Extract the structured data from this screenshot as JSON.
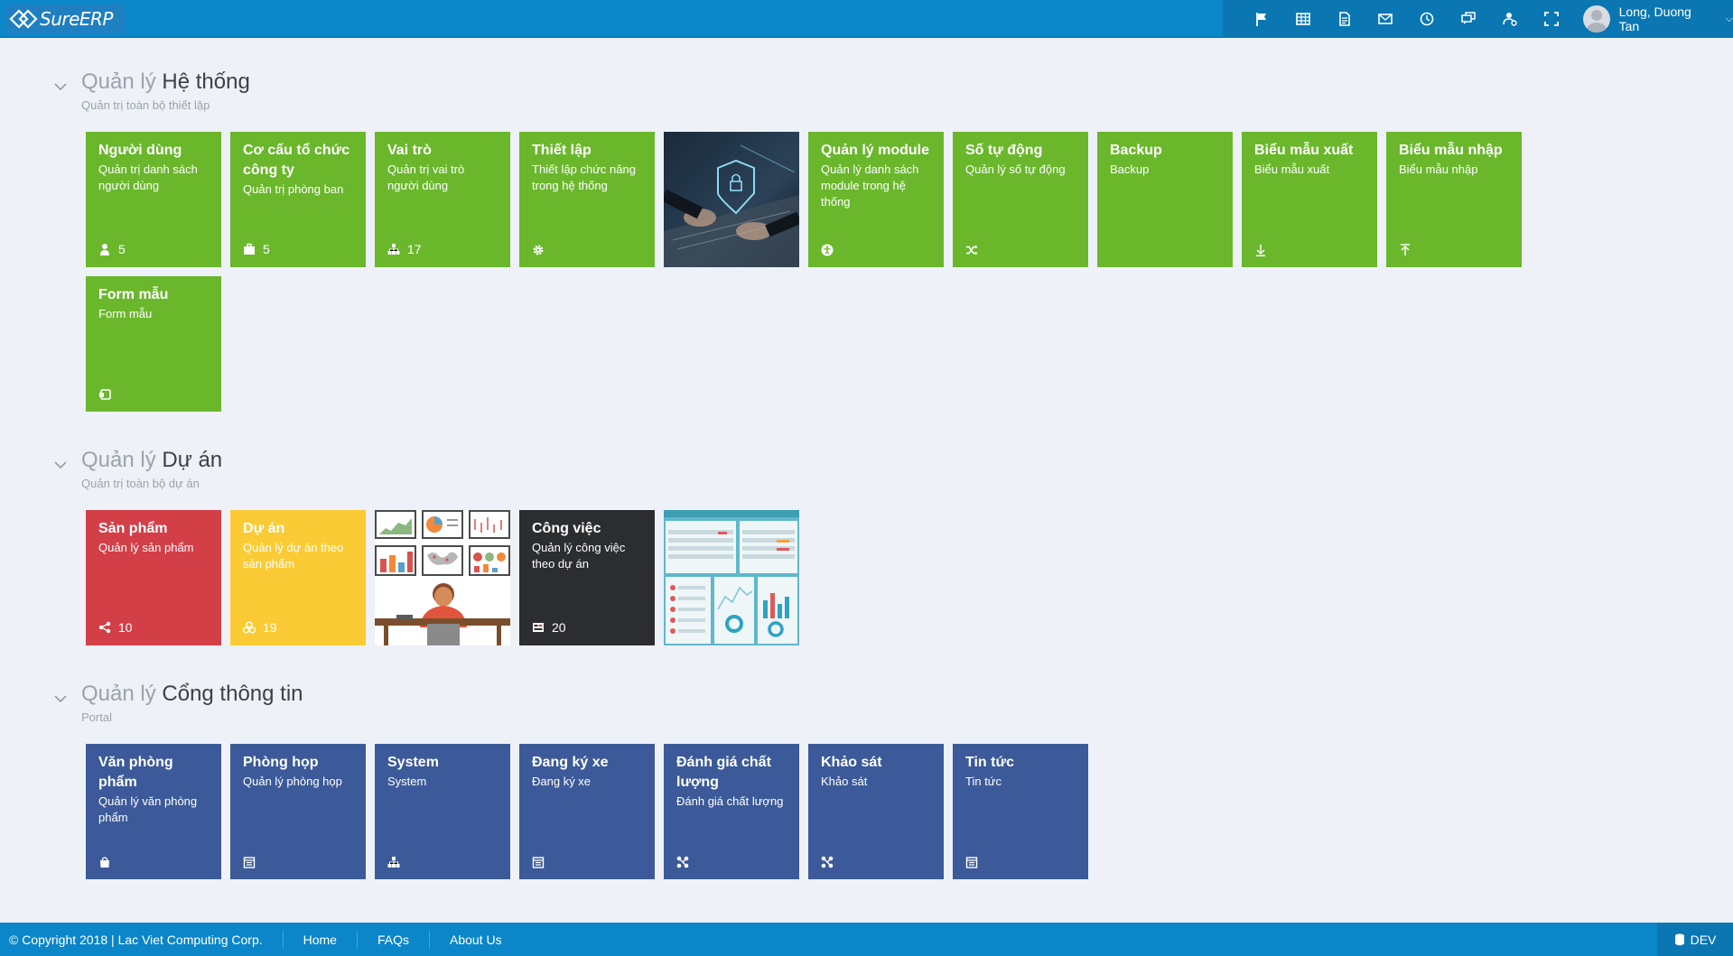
{
  "app": {
    "logo_text": "SureERP",
    "user_name": "Long, Duong Tan"
  },
  "toolbar_icons": [
    "flag-icon",
    "table-icon",
    "document-icon",
    "mail-icon",
    "clock-icon",
    "chat-icon",
    "user-settings-icon",
    "fullscreen-icon"
  ],
  "sections": [
    {
      "title_prefix": "Quản lý",
      "title_main": "Hệ thống",
      "subtitle": "Quản trị toàn bộ thiết lập",
      "tiles": [
        {
          "title": "Người dùng",
          "desc": "Quản trị danh sách người dùng",
          "icon": "user-icon",
          "count": "5"
        },
        {
          "title": "Cơ cấu tổ chức công ty",
          "desc": "Quản trị phòng ban",
          "icon": "briefcase-icon",
          "count": "5"
        },
        {
          "title": "Vai trò",
          "desc": "Quản trị vai trò người dùng",
          "icon": "sitemap-icon",
          "count": "17"
        },
        {
          "title": "Thiết lập",
          "desc": "Thiết lập chức năng trong hệ thống",
          "icon": "gear-icon",
          "count": ""
        },
        {
          "title": "Quản lý module",
          "desc": "Quản lý danh sách module trong hệ thống",
          "icon": "accessibility-icon",
          "count": ""
        },
        {
          "title": "Số tự động",
          "desc": "Quản lý số tự động",
          "icon": "shuffle-icon",
          "count": ""
        },
        {
          "title": "Backup",
          "desc": "Backup",
          "icon": "",
          "count": ""
        },
        {
          "title": "Biểu mẫu xuất",
          "desc": "Biểu mẫu xuất",
          "icon": "download-icon",
          "count": ""
        },
        {
          "title": "Biểu mẫu nhập",
          "desc": "Biểu mẫu nhập",
          "icon": "upload-icon",
          "count": ""
        },
        {
          "title": "Form mẫu",
          "desc": "Form mẫu",
          "icon": "form-icon",
          "count": ""
        }
      ],
      "image_tile": "protected-image"
    },
    {
      "title_prefix": "Quản lý",
      "title_main": "Dự án",
      "subtitle": "Quản trị toàn bộ dự án",
      "tiles": [
        {
          "title": "Sản phẩm",
          "desc": "Quản lý sản phẩm",
          "icon": "share-icon",
          "count": "10"
        },
        {
          "title": "Dự án",
          "desc": "Quản lý dự án theo sản phẩm",
          "icon": "cubes-icon",
          "count": "19"
        },
        {
          "title": "Công việc",
          "desc": "Quản lý công việc theo dự án",
          "icon": "tasks-icon",
          "count": "20"
        }
      ]
    },
    {
      "title_prefix": "Quản lý",
      "title_main": "Cổng thông tin",
      "subtitle": "Portal",
      "tiles": [
        {
          "title": "Văn phòng phẩm",
          "desc": "Quản lý văn phòng phẩm",
          "icon": "bag-icon",
          "count": ""
        },
        {
          "title": "Phòng họp",
          "desc": "Quản lý phòng họp",
          "icon": "calendar-icon",
          "count": ""
        },
        {
          "title": "System",
          "desc": "System",
          "icon": "sitemap-icon",
          "count": ""
        },
        {
          "title": "Đang ký xe",
          "desc": "Đang ký xe",
          "icon": "calendar-icon",
          "count": ""
        },
        {
          "title": "Đánh giá chất lượng",
          "desc": "Đánh giá chất lượng",
          "icon": "nodes-icon",
          "count": ""
        },
        {
          "title": "Khảo sát",
          "desc": "Khảo sát",
          "icon": "nodes-icon",
          "count": ""
        },
        {
          "title": "Tin tức",
          "desc": "Tin tức",
          "icon": "calendar-icon",
          "count": ""
        }
      ]
    }
  ],
  "footer": {
    "copyright": "© Copyright 2018 | Lac Viet Computing Corp.",
    "links": [
      "Home",
      "FAQs",
      "About Us"
    ],
    "env": "DEV"
  },
  "colors": {
    "topbar": "#0b86c8",
    "green": "#6ab72c",
    "red": "#d23f47",
    "yellow": "#fbcb35",
    "dark": "#2c2d30",
    "navy": "#3c5a99",
    "background": "#eef1f7"
  }
}
